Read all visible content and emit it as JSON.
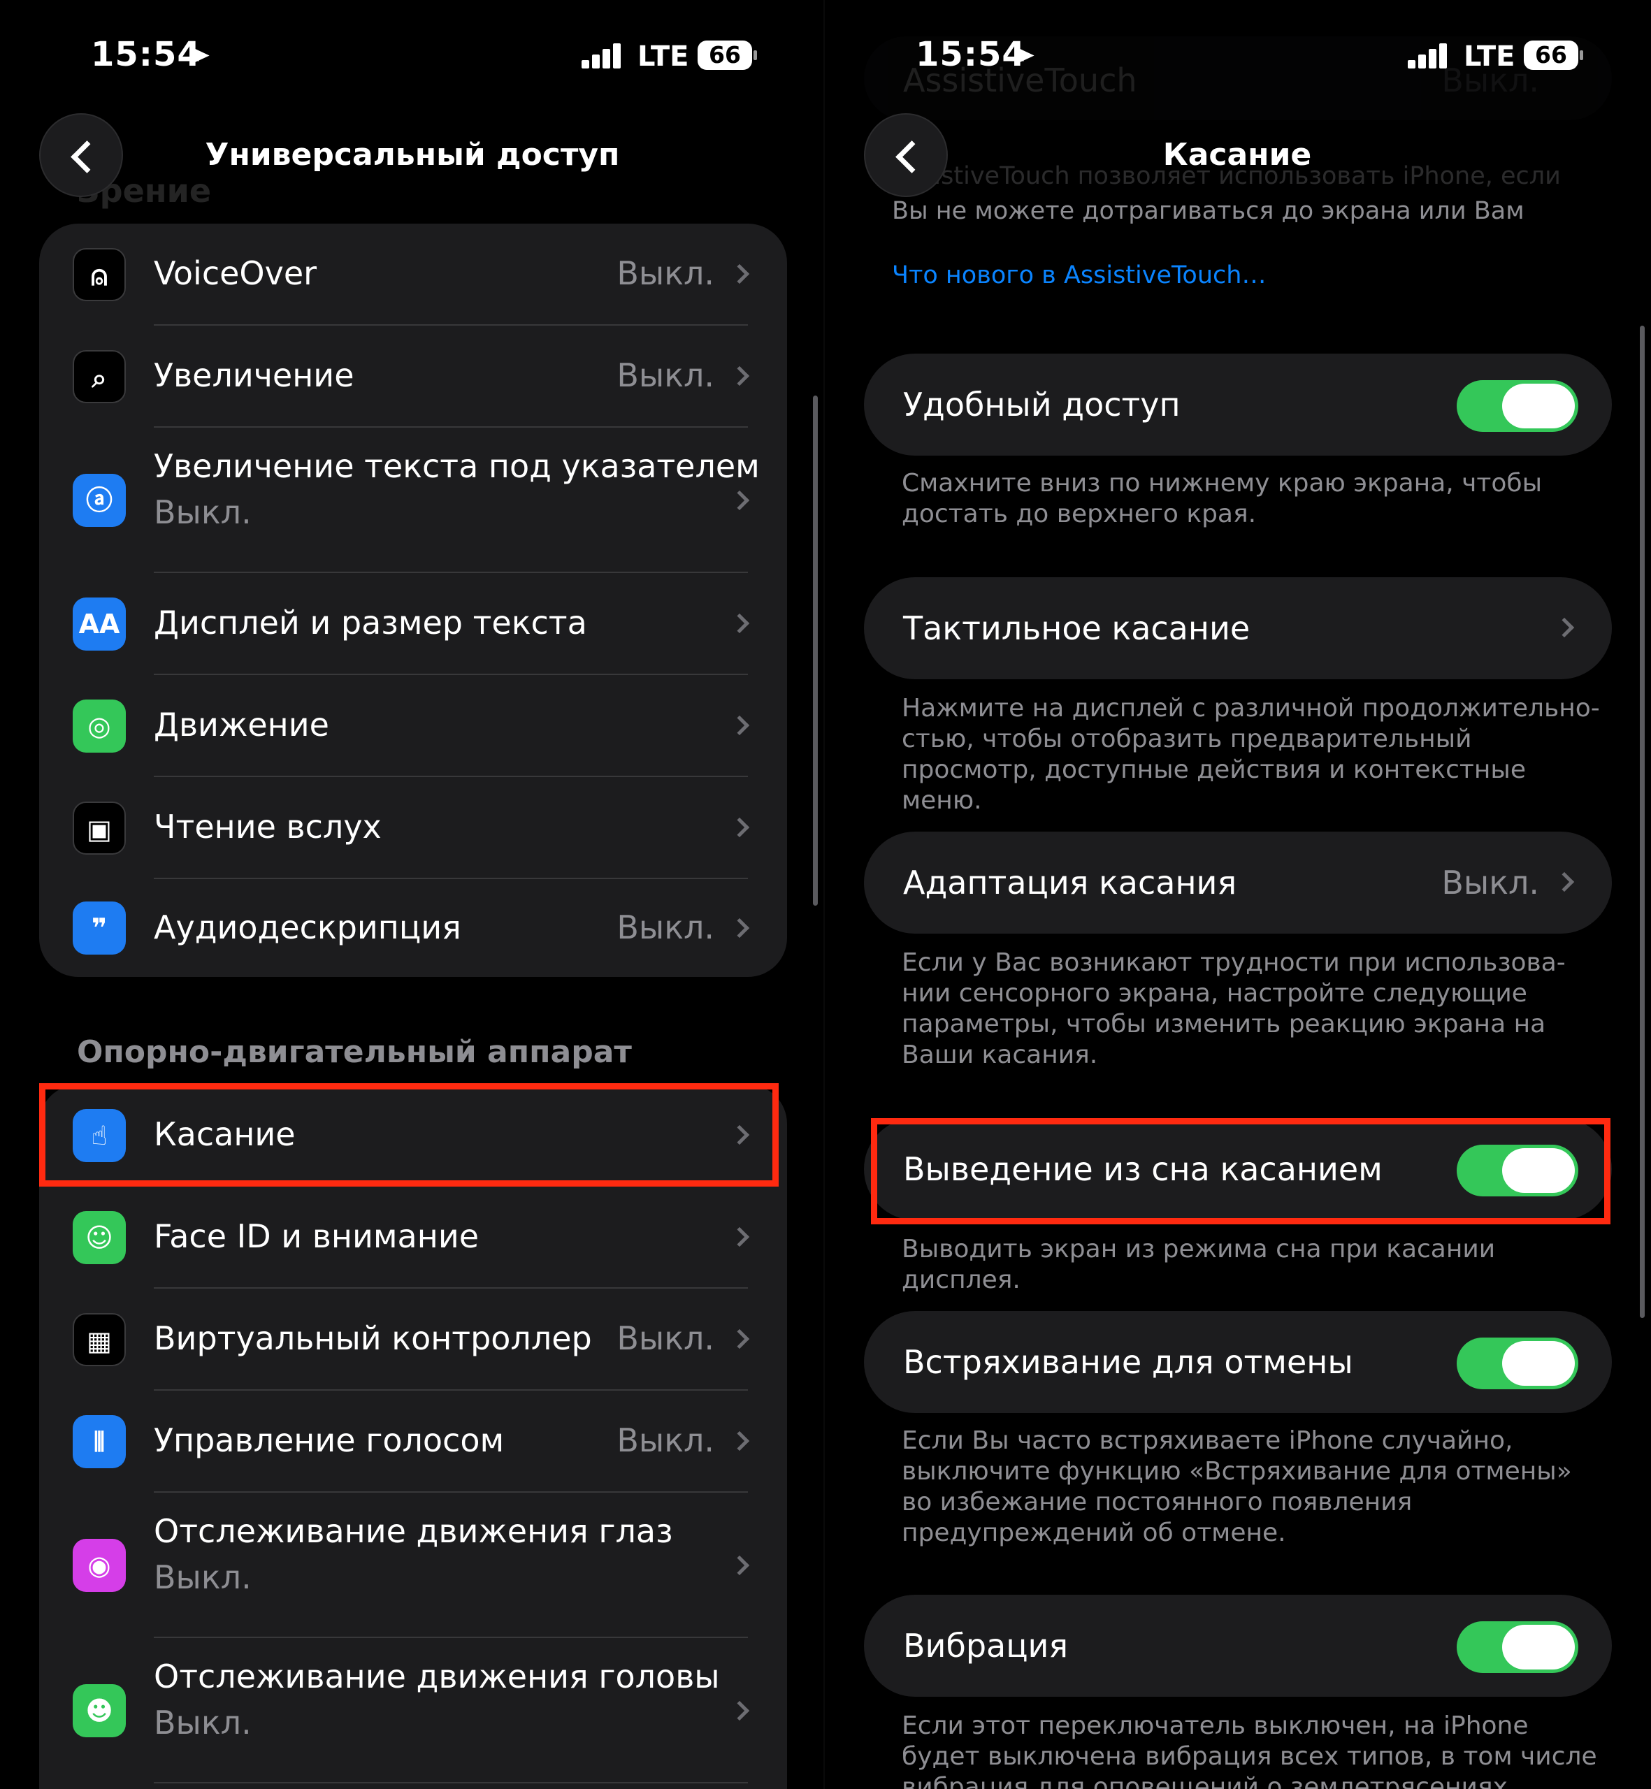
{
  "status_bar": {
    "time": "15:54",
    "network": "LTE",
    "battery": "66"
  },
  "left": {
    "title": "Универсальный доступ",
    "behind_header": "Зрение",
    "vision_items": [
      {
        "label": "VoiceOver",
        "value": "Выкл.",
        "icon": "voiceover-icon"
      },
      {
        "label": "Увеличение",
        "value": "Выкл.",
        "icon": "zoom-icon"
      },
      {
        "label": "Увеличение текста под указателем",
        "sub": "Выкл.",
        "icon": "hover-text-icon"
      },
      {
        "label": "Дисплей и размер текста",
        "icon": "text-size-icon",
        "icon_text": "AA"
      },
      {
        "label": "Движение",
        "icon": "motion-icon"
      },
      {
        "label": "Чтение вслух",
        "icon": "spoken-content-icon"
      },
      {
        "label": "Аудиодескрипция",
        "value": "Выкл.",
        "icon": "audio-description-icon"
      }
    ],
    "section_header": "Опорно-двигательный аппарат",
    "physical_items": [
      {
        "label": "Касание",
        "icon": "touch-icon"
      },
      {
        "label": "Face ID и внимание",
        "icon": "face-id-icon"
      },
      {
        "label": "Виртуальный контроллер",
        "value": "Выкл.",
        "icon": "switch-control-icon"
      },
      {
        "label": "Управление голосом",
        "value": "Выкл.",
        "icon": "voice-control-icon"
      },
      {
        "label": "Отслеживание движения глаз",
        "sub": "Выкл.",
        "icon": "eye-tracking-icon"
      },
      {
        "label": "Отслеживание движения головы",
        "sub": "Выкл.",
        "icon": "head-tracking-icon"
      }
    ]
  },
  "right": {
    "title": "Касание",
    "behind_row": {
      "label": "AssistiveTouch",
      "value": "Выкл."
    },
    "intro_line1": "AssistiveTouch позволяет использовать iPhone, если",
    "intro_line2": "Вы не можете дотрагиваться до экрана или Вам",
    "link": "Что нового в AssistiveTouch…",
    "cells": [
      {
        "label": "Удобный доступ",
        "type": "toggle",
        "on": true,
        "footer": "Смахните вниз по нижнему краю экрана, чтобы достать до верхнего края."
      },
      {
        "label": "Тактильное касание",
        "type": "link",
        "footer": "Нажмите на дисплей с различной продолжительно-стью, чтобы отобразить предварительный просмотр, доступные действия и контекстные меню."
      },
      {
        "label": "Адаптация касания",
        "type": "link",
        "value": "Выкл.",
        "footer": "Если у Вас возникают трудности при использова-нии сенсорного экрана, настройте следующие параметры, чтобы изменить реакцию экрана на Ваши касания."
      },
      {
        "label": "Выведение из сна касанием",
        "type": "toggle",
        "on": true,
        "footer": "Выводить экран из режима сна при касании дисплея."
      },
      {
        "label": "Встряхивание для отмены",
        "type": "toggle",
        "on": true,
        "footer": "Если Вы часто встряхиваете iPhone случайно, выключите функцию «Встряхивание для отмены» во избежание постоянного появления предупреждений об отмене."
      },
      {
        "label": "Вибрация",
        "type": "toggle",
        "on": true,
        "footer": "Если этот переключатель выключен, на iPhone будет выключена вибрация всех типов, в том числе вибрация для оповещений о землетрясениях, цунами"
      }
    ]
  },
  "colors": {
    "highlight": "#ff2a10",
    "toggle_on": "#34c759",
    "link": "#0a84ff"
  }
}
